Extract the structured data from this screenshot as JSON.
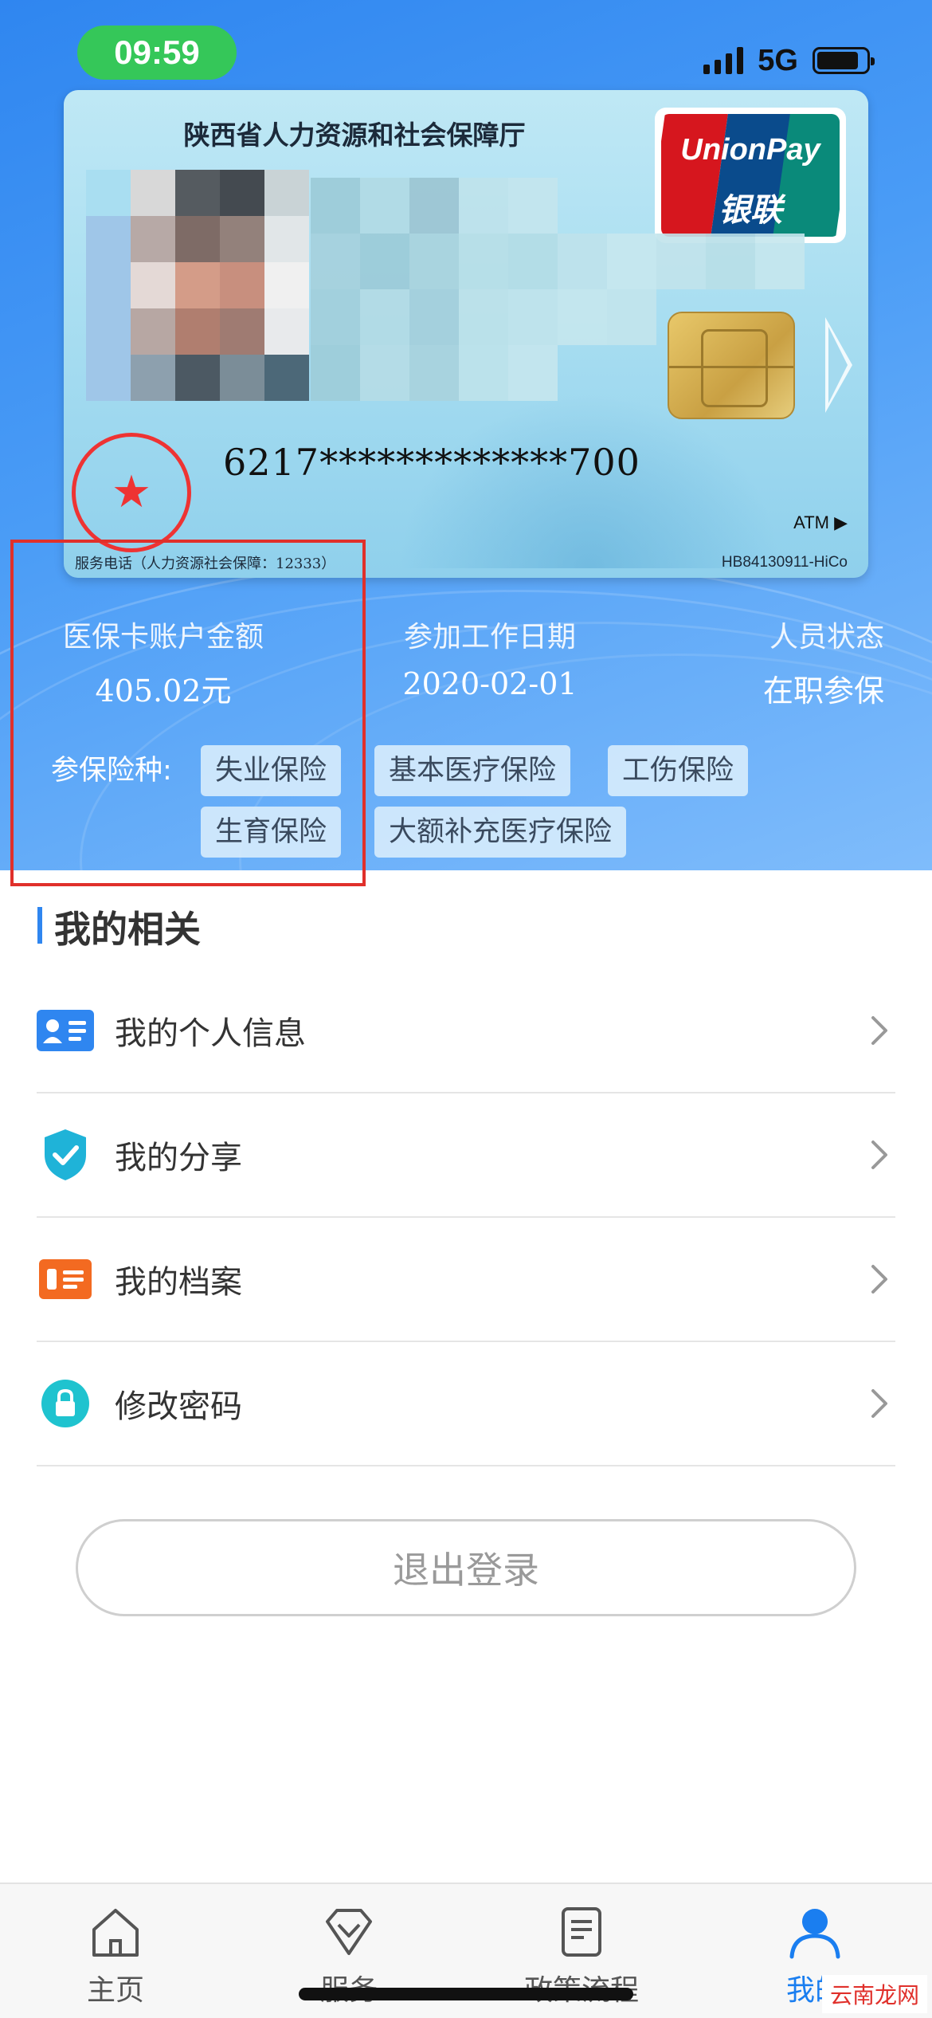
{
  "status_bar": {
    "time": "09:59",
    "network": "5G"
  },
  "card": {
    "issuer": "陕西省人力资源和社会保障厅",
    "brand_en": "UnionPay",
    "brand_cn": "银联",
    "number": "6217*************700",
    "atm": "ATM ▶",
    "service_phone": "服务电话（人力资源社会保障：12333）",
    "code": "HB84130911-HiCo"
  },
  "stats": {
    "balance_label": "医保卡账户金额",
    "balance_value": "405.02元",
    "work_date_label": "参加工作日期",
    "work_date_value": "2020-02-01",
    "status_label": "人员状态",
    "status_value": "在职参保"
  },
  "insurance": {
    "label": "参保险种:",
    "types": [
      "失业保险",
      "基本医疗保险",
      "工伤保险",
      "生育保险",
      "大额补充医疗保险"
    ]
  },
  "my_section": {
    "title": "我的相关",
    "items": [
      {
        "label": "我的个人信息",
        "icon": "id-card-icon"
      },
      {
        "label": "我的分享",
        "icon": "shield-check-icon"
      },
      {
        "label": "我的档案",
        "icon": "archive-icon"
      },
      {
        "label": "修改密码",
        "icon": "lock-icon"
      }
    ]
  },
  "logout_label": "退出登录",
  "tabbar": {
    "items": [
      {
        "label": "主页",
        "icon": "home-icon"
      },
      {
        "label": "服务",
        "icon": "diamond-icon"
      },
      {
        "label": "政策流程",
        "icon": "document-icon"
      },
      {
        "label": "我的",
        "icon": "person-icon"
      }
    ],
    "active_index": 3
  },
  "watermark": "云南龙网",
  "colors": {
    "primary": "#2f86f0",
    "highlight": "#e0302b",
    "status_time_bg": "#35c759"
  }
}
